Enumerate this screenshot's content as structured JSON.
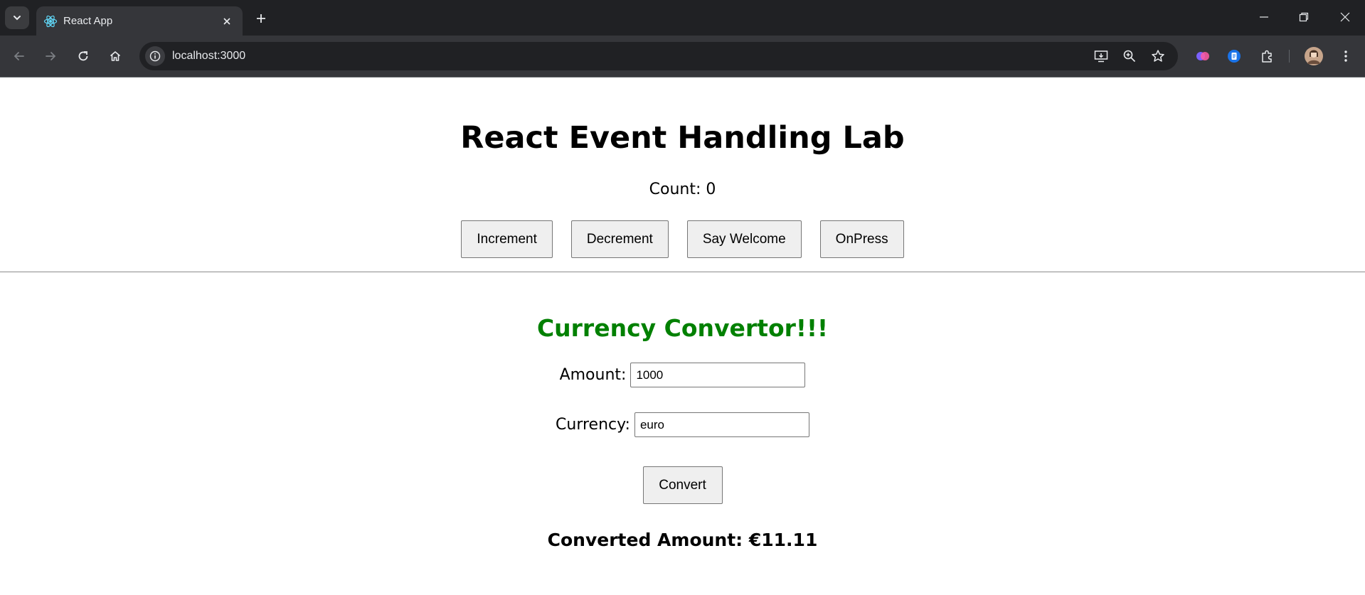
{
  "browser": {
    "tab_title": "React App",
    "url": "localhost:3000"
  },
  "page": {
    "title": "React Event Handling Lab",
    "count_text": "Count: 0",
    "buttons": {
      "increment": "Increment",
      "decrement": "Decrement",
      "say_welcome": "Say Welcome",
      "onpress": "OnPress"
    },
    "converter": {
      "title": "Currency Convertor!!!",
      "amount_label": "Amount:",
      "amount_value": "1000",
      "currency_label": "Currency:",
      "currency_value": "euro",
      "convert_label": "Convert",
      "result_text": "Converted Amount: €11.11"
    }
  },
  "colors": {
    "converter_title": "#008000",
    "chrome_dark": "#202124",
    "chrome_toolbar": "#35363a"
  },
  "icons": [
    "tab-search-icon",
    "react-favicon-icon",
    "close-icon",
    "plus-icon",
    "minimize-icon",
    "restore-icon",
    "back-icon",
    "forward-icon",
    "reload-icon",
    "home-icon",
    "site-info-icon",
    "install-icon",
    "zoom-icon",
    "star-icon",
    "extension-icon",
    "puzzle-icon",
    "avatar",
    "kebab-menu-icon"
  ]
}
